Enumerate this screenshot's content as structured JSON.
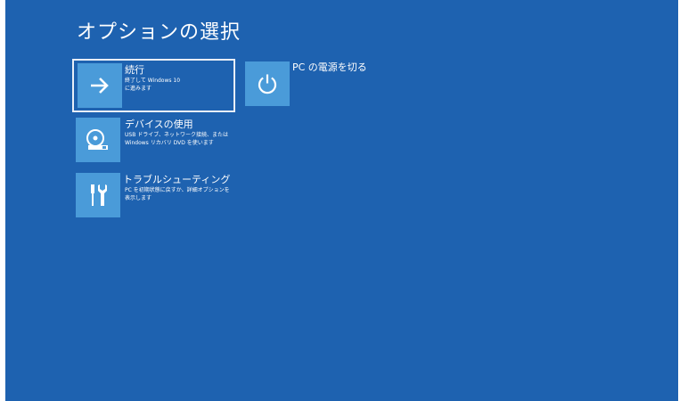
{
  "colors": {
    "background": "#1e62b0",
    "tile": "#4a9bd9",
    "text": "#ffffff"
  },
  "page": {
    "title": "オプションの選択"
  },
  "options": {
    "continue": {
      "icon": "arrow-right-icon",
      "title": "続行",
      "desc_line1": "終了して Windows 10",
      "desc_line2": "に進みます"
    },
    "use_device": {
      "icon": "disc-drive-icon",
      "title": "デバイスの使用",
      "desc_line1": "USB ドライブ、ネットワーク接続、または",
      "desc_line2": "Windows リカバリ DVD を使います"
    },
    "troubleshoot": {
      "icon": "tools-icon",
      "title": "トラブルシューティング",
      "desc_line1": "PC を初期状態に戻すか、詳細オプションを",
      "desc_line2": "表示します"
    },
    "power_off": {
      "icon": "power-icon",
      "title": "PC の電源を切る"
    }
  }
}
